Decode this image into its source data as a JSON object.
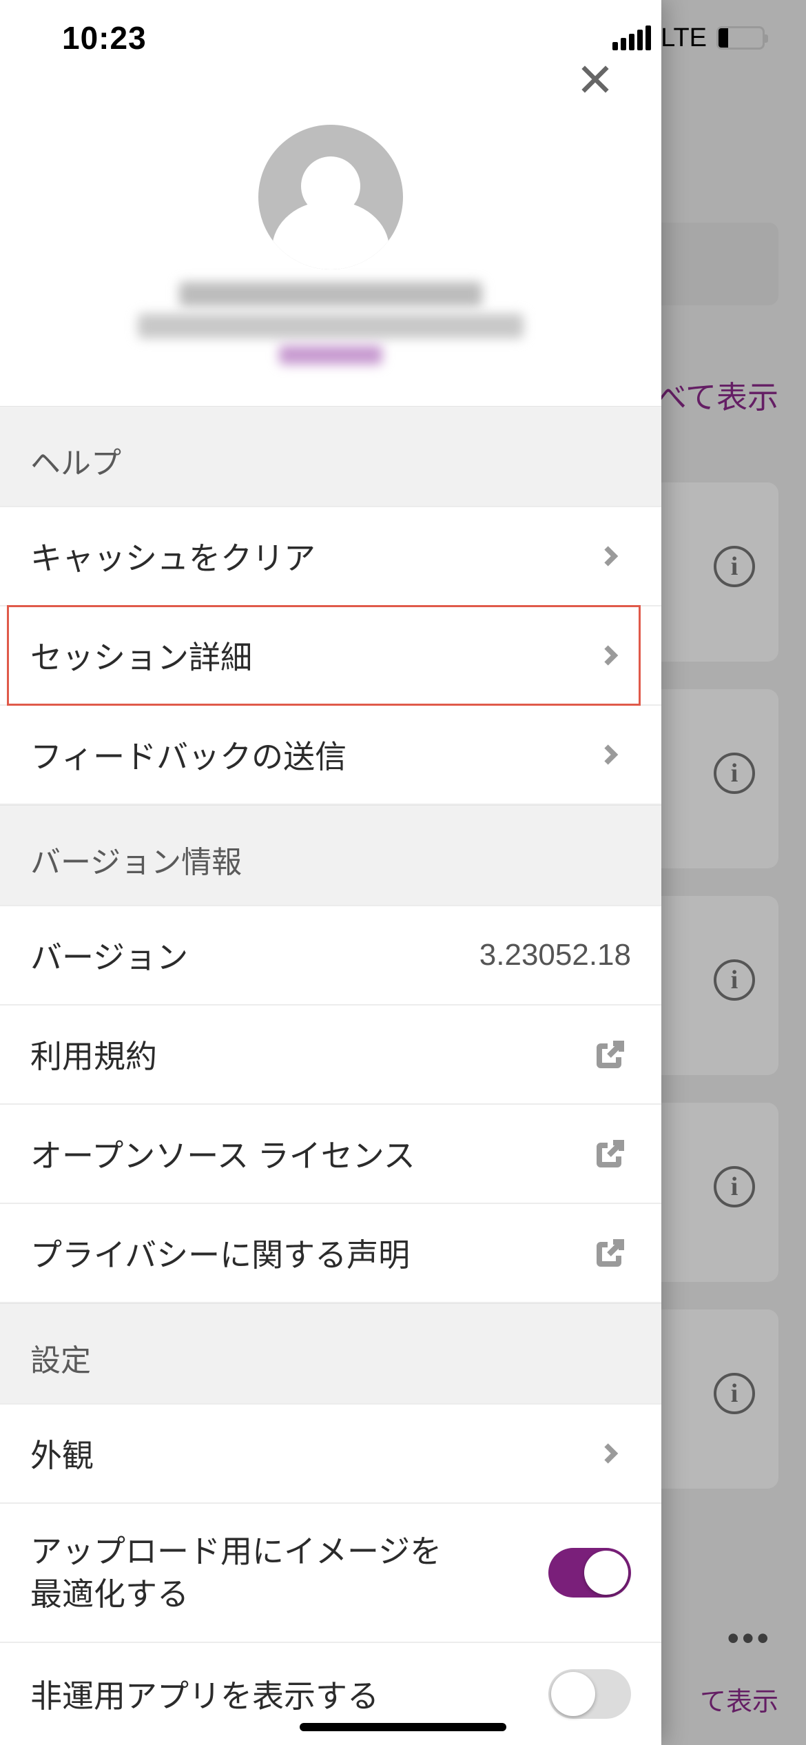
{
  "status_bar": {
    "time": "10:23",
    "network": "LTE"
  },
  "background": {
    "show_all": "べて表示",
    "show_all_small": "て表示",
    "more": "•••"
  },
  "profile": {},
  "sections": {
    "help": {
      "header": "ヘルプ",
      "clear_cache": "キャッシュをクリア",
      "session_details": "セッション詳細",
      "send_feedback": "フィードバックの送信"
    },
    "version": {
      "header": "バージョン情報",
      "version_label": "バージョン",
      "version_value": "3.23052.18",
      "terms": "利用規約",
      "oss_license": "オープンソース ライセンス",
      "privacy": "プライバシーに関する声明"
    },
    "settings": {
      "header": "設定",
      "appearance": "外観",
      "optimize_images": "アップロード用にイメージを最適化する",
      "show_nonprod": "非運用アプリを表示する"
    }
  }
}
